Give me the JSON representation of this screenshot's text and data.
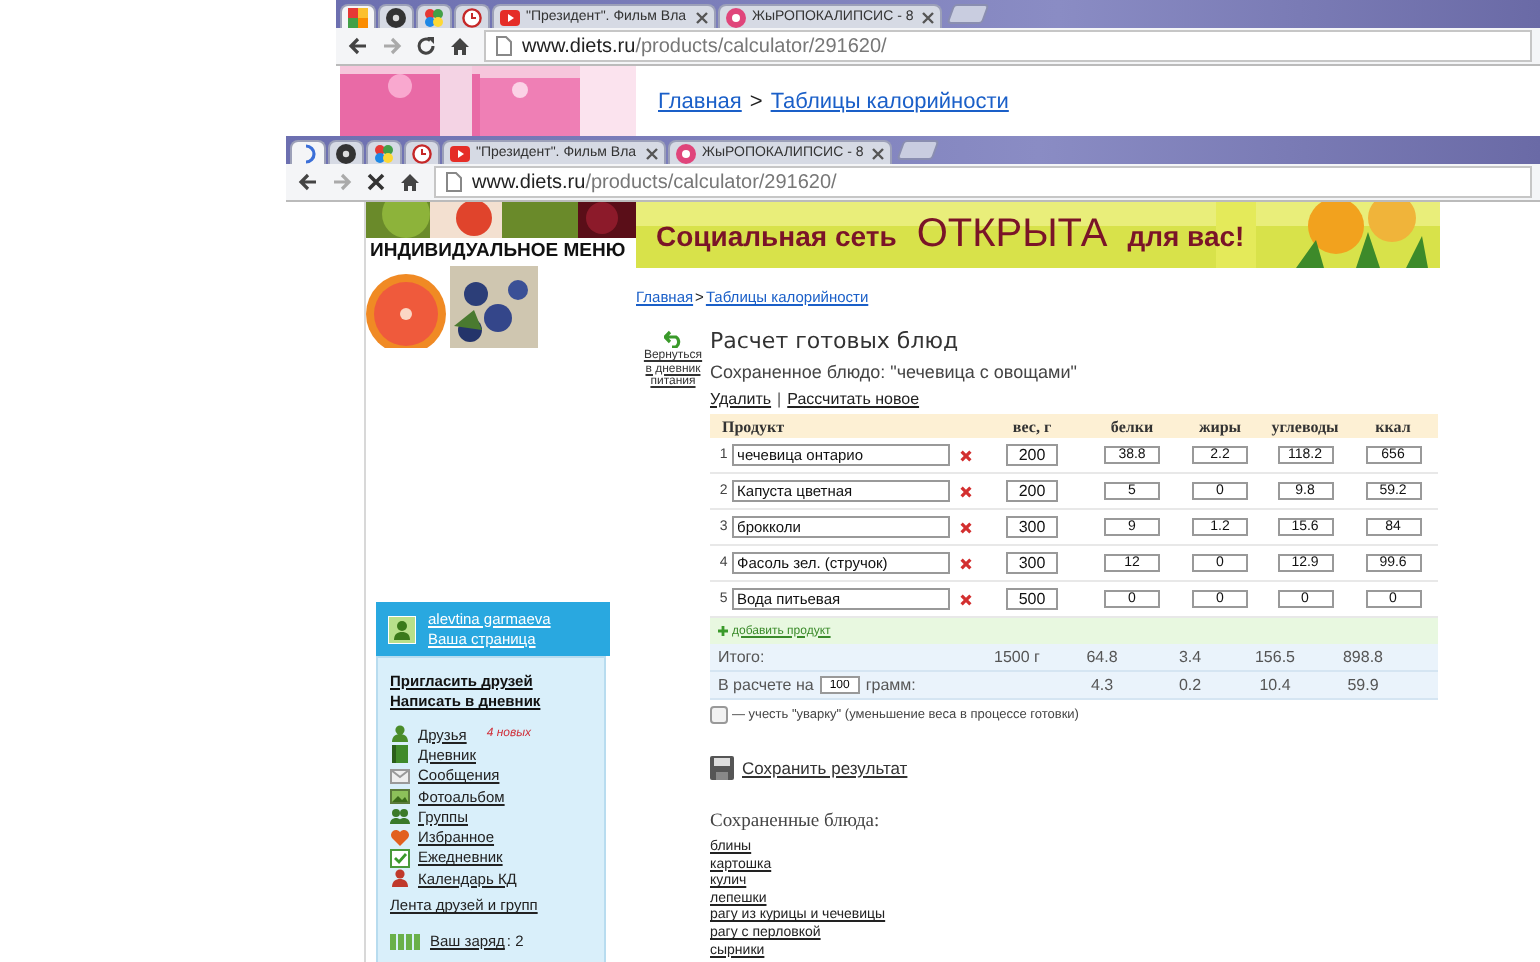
{
  "background_window": {
    "tabs": [
      {
        "selected": true
      },
      {
        "selected": false
      },
      {
        "selected": false
      },
      {
        "selected": false
      },
      {
        "title": "\"Президент\". Фильм Вла",
        "selected": false
      },
      {
        "title": "ЖыРОПОКАЛИПСИС - 8",
        "selected": false
      }
    ],
    "address": {
      "host": "www.diets.ru",
      "path": "/products/calculator/291620/"
    },
    "breadcrumb": [
      {
        "label": "Главная"
      },
      {
        "label": "Таблицы калорийности"
      }
    ],
    "separator": ">"
  },
  "window": {
    "tabs": [
      {
        "selected": true
      },
      {
        "selected": false
      },
      {
        "selected": false
      },
      {
        "selected": false
      },
      {
        "title": "\"Президент\". Фильм Вла",
        "selected": false
      },
      {
        "title": "ЖыРОПОКАЛИПСИС - 8",
        "selected": false
      }
    ],
    "address": {
      "host": "www.diets.ru",
      "path": "/products/calculator/291620/"
    },
    "menu_title": "ИНДИВИДУАЛЬНОЕ МЕНЮ",
    "banner": {
      "before": "Социальная сеть",
      "highlight": "ОТКРЫТА",
      "after": "для вас!"
    },
    "breadcrumb": [
      {
        "label": "Главная"
      },
      {
        "label": "Таблицы калорийности"
      }
    ],
    "separator": ">",
    "back_link": "Вернуться в дневник питания",
    "title": "Расчет готовых блюд",
    "saved_dish": "Сохраненное блюдо: \"чечевица с овощами\"",
    "actions": [
      "Удалить",
      "Рассчитать новое"
    ],
    "actions_separator": "|",
    "table": {
      "columns": [
        "Продукт",
        "вес, г",
        "белки",
        "жиры",
        "углеводы",
        "ккал"
      ],
      "rows": [
        {
          "number": "1",
          "product": "чечевица онтарио",
          "weight": "200",
          "values": [
            "38.8",
            "2.2",
            "118.2",
            "656"
          ]
        },
        {
          "number": "2",
          "product": "Капуста цветная",
          "weight": "200",
          "values": [
            "5",
            "0",
            "9.8",
            "59.2"
          ]
        },
        {
          "number": "3",
          "product": "брокколи",
          "weight": "300",
          "values": [
            "9",
            "1.2",
            "15.6",
            "84"
          ]
        },
        {
          "number": "4",
          "product": "Фасоль зел. (стручок)",
          "weight": "300",
          "values": [
            "12",
            "0",
            "12.9",
            "99.6"
          ]
        },
        {
          "number": "5",
          "product": "Вода питьевая",
          "weight": "500",
          "values": [
            "0",
            "0",
            "0",
            "0"
          ]
        }
      ],
      "add_product": "добавить продукт",
      "total": {
        "label": "Итого:",
        "weight": "1500 г",
        "values": [
          "64.8",
          "3.4",
          "156.5",
          "898.8"
        ]
      },
      "per": {
        "before": "В расчете на",
        "amount": "100",
        "after": "грамм:",
        "values": [
          "4.3",
          "0.2",
          "10.4",
          "59.9"
        ]
      }
    },
    "boil_off": {
      "checked": false,
      "label": "— учесть \"уварку\" (уменьшение веса в процессе готовки)"
    },
    "save": "Сохранить результат",
    "saved_title": "Сохраненные блюда:",
    "saved_list": [
      "блины",
      "картошка",
      "кулич",
      "лепешки",
      "рагу из курицы и чечевицы",
      "рагу с перловкой",
      "сырники"
    ],
    "profile": {
      "name": "alevtina garmaeva",
      "page": "Ваша страница"
    },
    "sidebar": {
      "top_links": [
        "Пригласить друзей",
        "Написать в дневник"
      ],
      "items": [
        {
          "label": "Друзья",
          "badge": "4 новых"
        },
        {
          "label": "Дневник"
        },
        {
          "label": "Сообщения"
        },
        {
          "label": "Фотоальбом"
        },
        {
          "label": "Группы"
        },
        {
          "label": "Избранное"
        },
        {
          "label": "Ежедневник"
        },
        {
          "label": "Календарь КД"
        }
      ],
      "feed": "Лента друзей и групп",
      "charge": {
        "label": "Ваш заряд",
        "value": ": 2"
      }
    }
  }
}
